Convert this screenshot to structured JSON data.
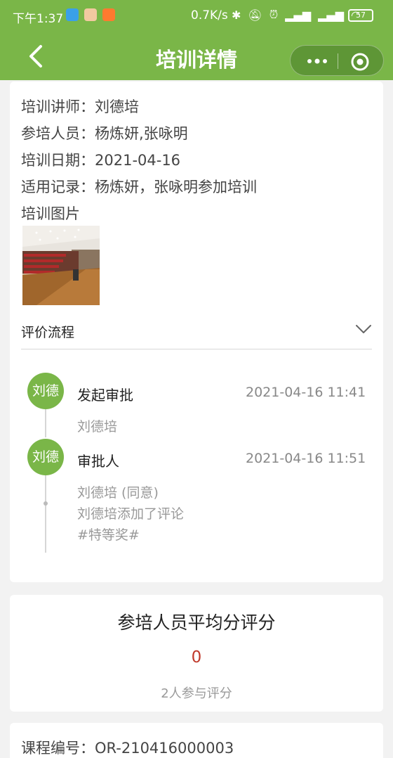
{
  "status_bar": {
    "time": "下午1:37",
    "network_speed": "0.7K/s",
    "battery": "57"
  },
  "nav": {
    "title": "培训详情"
  },
  "info": {
    "trainer": "培训讲师：刘德培",
    "participants": "参培人员：杨炼妍,张咏明",
    "date": "培训日期：2021-04-16",
    "record": "适用记录：杨炼妍，张咏明参加培训",
    "photos_label": "培训图片"
  },
  "evaluation": {
    "header": "评价流程",
    "steps": [
      {
        "avatar": "刘德",
        "title": "发起审批",
        "time": "2021-04-16 11:41",
        "lines": [
          "刘德培"
        ]
      },
      {
        "avatar": "刘德",
        "title": "审批人",
        "time": "2021-04-16 11:51",
        "lines": [
          "刘德培 (同意)",
          "刘德培添加了评论",
          "#特等奖#"
        ]
      }
    ]
  },
  "score": {
    "title": "参培人员平均分评分",
    "value": "0",
    "count": "2人参与评分"
  },
  "course": {
    "code": "课程编号：OR-210416000003"
  },
  "colors": {
    "brand": "#7ab648",
    "score": "#c0392b"
  }
}
